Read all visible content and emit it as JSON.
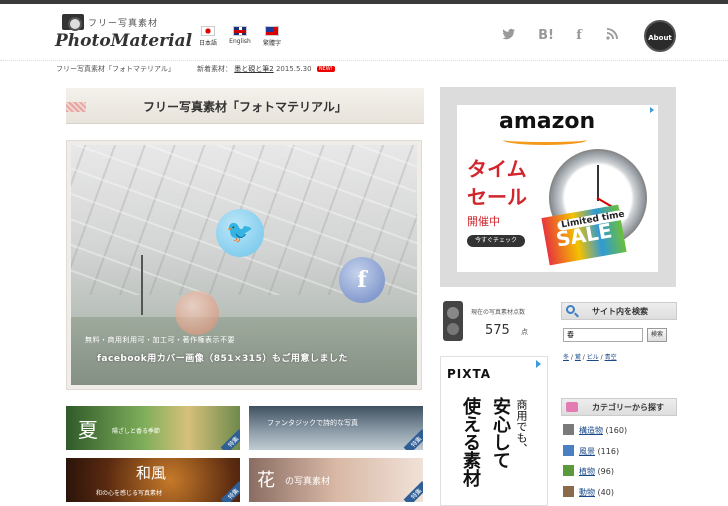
{
  "header": {
    "logo_tagline": "フリー写真素材",
    "logo_name": "PhotoMaterial",
    "languages": [
      {
        "label": "日本語"
      },
      {
        "label": "English"
      },
      {
        "label": "繁體字"
      }
    ],
    "social": [
      "twitter-icon",
      "hatena-bookmark-icon",
      "facebook-icon",
      "rss-icon"
    ],
    "hatena_label": "B!",
    "facebook_label": "f",
    "about_label": "About"
  },
  "subbar": {
    "breadcrumb": "フリー写真素材「フォトマテリアル」",
    "newest_label": "新着素材：",
    "newest_link": "墨と硯と筆2",
    "newest_date": "2015.5.30",
    "new_badge": "NEW!"
  },
  "main": {
    "title": "フリー写真素材「フォトマテリアル」",
    "hero_line1": "無料・商用利用可・加工可・著作権表示不要",
    "hero_line2": "facebook用カバー画像（851×315）もご用意しました",
    "twitter_glyph": "🐦",
    "facebook_glyph": "f",
    "banners": [
      {
        "big": "夏",
        "small": "陽ざしと香る季節",
        "ribbon": "特集"
      },
      {
        "big": "",
        "small": "ファンタジックで詩的な写真",
        "ribbon": "特集"
      },
      {
        "big": "和風",
        "small": "和の心を感じる写真素材",
        "ribbon": "特集"
      },
      {
        "big": "花",
        "small": "の写真素材",
        "ribbon": "特集"
      }
    ]
  },
  "sidebar": {
    "ad": {
      "brand": "amazon",
      "line1": "タイム",
      "line2": "セール",
      "line3": "開催中",
      "button": "今すぐチェック",
      "badge_text": "Limited time",
      "sale_text": "SALE"
    },
    "counter": {
      "label": "現在の写真素材点数",
      "value": "575",
      "unit": "点"
    },
    "search": {
      "heading": "サイト内を検索",
      "input_value": "春",
      "button": "検索",
      "tags": [
        "冬",
        "鷲",
        "ビル",
        "青空"
      ]
    },
    "pixta": {
      "logo": "PIXTA",
      "col1": "商用でも、",
      "col2": "安心して",
      "col3": "使える素材"
    },
    "categories": {
      "heading": "カテゴリーから探す",
      "items": [
        {
          "name": "構造物",
          "count": "(160)",
          "color": "#7a7a7a"
        },
        {
          "name": "風景",
          "count": "(116)",
          "color": "#4a7fc0"
        },
        {
          "name": "植物",
          "count": "(96)",
          "color": "#5a9a3a"
        },
        {
          "name": "動物",
          "count": "(40)",
          "color": "#8a6a4a"
        }
      ]
    }
  }
}
